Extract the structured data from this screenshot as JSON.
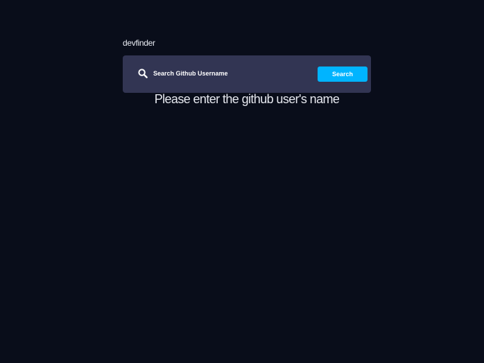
{
  "app": {
    "title": "devfinder"
  },
  "search": {
    "icon": "search-icon",
    "placeholder": "Search Github Username",
    "value": "",
    "button_label": "Search"
  },
  "main": {
    "message": "Please enter the github user's name"
  },
  "colors": {
    "background": "#090d1a",
    "search_bar": "#323553",
    "accent": "#00b4ff",
    "text": "#ffffff"
  }
}
